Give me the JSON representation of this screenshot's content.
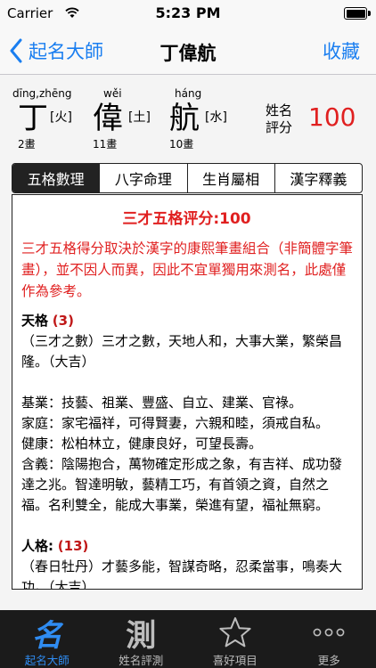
{
  "status_bar": {
    "carrier": "Carrier",
    "time": "5:23 PM"
  },
  "nav": {
    "back_label": "起名大師",
    "title": "丁偉航",
    "right_label": "收藏"
  },
  "name_header": {
    "characters": [
      {
        "pinyin": "dīng,zhēng",
        "hanzi": "丁",
        "element": "[火]",
        "strokes": "2畫"
      },
      {
        "pinyin": "wěi",
        "hanzi": "偉",
        "element": "[土]",
        "strokes": "11畫"
      },
      {
        "pinyin": "háng",
        "hanzi": "航",
        "element": "[水]",
        "strokes": "10畫"
      }
    ],
    "score_label_1": "姓名",
    "score_label_2": "評分",
    "score_value": "100"
  },
  "tabs": [
    {
      "label": "五格數理",
      "active": true
    },
    {
      "label": "八字命理",
      "active": false
    },
    {
      "label": "生肖屬相",
      "active": false
    },
    {
      "label": "漢字釋義",
      "active": false
    }
  ],
  "content": {
    "title": "三才五格评分:100",
    "intro": "三才五格得分取決於漢字的康熙筆畫組合（非簡體字筆畫），並不因人而異，因此不宜單獨用來測名，此處僅作為參考。",
    "tiange": {
      "head": "天格",
      "num": "(3)",
      "desc": "（三才之數）三才之數，天地人和，大事大業，繁榮昌隆。（大吉）",
      "jiye": "基業：技藝、祖業、豐盛、自立、建業、官祿。",
      "jiating": "家庭：家宅福祥，可得賢妻，六親和睦，須戒自私。",
      "jiankang": "健康：松柏林立，健康良好，可望長壽。",
      "hanyi": "含義：陰陽抱合，萬物確定形成之象，有吉祥、成功發達之兆。智達明敏，藝精工巧，有首領之資，自然之福。名利雙全，能成大事業，榮進有望，福祉無窮。"
    },
    "renge": {
      "head": "人格:",
      "num": "(13)",
      "desc": "（春日牡丹）才藝多能，智謀奇略，忍柔當事，鳴奏大功。（大吉）"
    }
  },
  "tab_bar": [
    {
      "glyph": "名",
      "label": "起名大師",
      "active": true
    },
    {
      "glyph": "測",
      "label": "姓名評測",
      "active": false
    },
    {
      "glyph": "",
      "label": "喜好項目",
      "active": false
    },
    {
      "glyph": "",
      "label": "更多",
      "active": false
    }
  ],
  "colors": {
    "accent": "#1a7ef0",
    "score_red": "#e02020",
    "tab_bar_bg": "#1b1b1b"
  }
}
